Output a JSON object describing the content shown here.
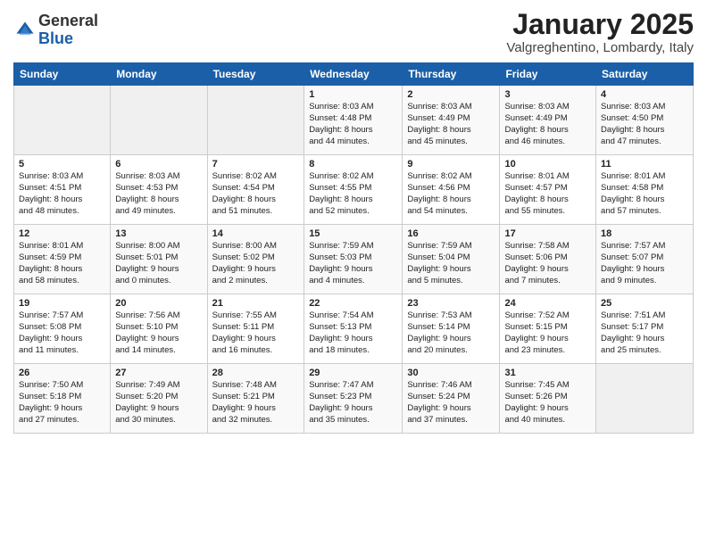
{
  "logo": {
    "general": "General",
    "blue": "Blue"
  },
  "header": {
    "month": "January 2025",
    "location": "Valgreghentino, Lombardy, Italy"
  },
  "weekdays": [
    "Sunday",
    "Monday",
    "Tuesday",
    "Wednesday",
    "Thursday",
    "Friday",
    "Saturday"
  ],
  "weeks": [
    [
      {
        "day": "",
        "info": ""
      },
      {
        "day": "",
        "info": ""
      },
      {
        "day": "",
        "info": ""
      },
      {
        "day": "1",
        "info": "Sunrise: 8:03 AM\nSunset: 4:48 PM\nDaylight: 8 hours\nand 44 minutes."
      },
      {
        "day": "2",
        "info": "Sunrise: 8:03 AM\nSunset: 4:49 PM\nDaylight: 8 hours\nand 45 minutes."
      },
      {
        "day": "3",
        "info": "Sunrise: 8:03 AM\nSunset: 4:49 PM\nDaylight: 8 hours\nand 46 minutes."
      },
      {
        "day": "4",
        "info": "Sunrise: 8:03 AM\nSunset: 4:50 PM\nDaylight: 8 hours\nand 47 minutes."
      }
    ],
    [
      {
        "day": "5",
        "info": "Sunrise: 8:03 AM\nSunset: 4:51 PM\nDaylight: 8 hours\nand 48 minutes."
      },
      {
        "day": "6",
        "info": "Sunrise: 8:03 AM\nSunset: 4:53 PM\nDaylight: 8 hours\nand 49 minutes."
      },
      {
        "day": "7",
        "info": "Sunrise: 8:02 AM\nSunset: 4:54 PM\nDaylight: 8 hours\nand 51 minutes."
      },
      {
        "day": "8",
        "info": "Sunrise: 8:02 AM\nSunset: 4:55 PM\nDaylight: 8 hours\nand 52 minutes."
      },
      {
        "day": "9",
        "info": "Sunrise: 8:02 AM\nSunset: 4:56 PM\nDaylight: 8 hours\nand 54 minutes."
      },
      {
        "day": "10",
        "info": "Sunrise: 8:01 AM\nSunset: 4:57 PM\nDaylight: 8 hours\nand 55 minutes."
      },
      {
        "day": "11",
        "info": "Sunrise: 8:01 AM\nSunset: 4:58 PM\nDaylight: 8 hours\nand 57 minutes."
      }
    ],
    [
      {
        "day": "12",
        "info": "Sunrise: 8:01 AM\nSunset: 4:59 PM\nDaylight: 8 hours\nand 58 minutes."
      },
      {
        "day": "13",
        "info": "Sunrise: 8:00 AM\nSunset: 5:01 PM\nDaylight: 9 hours\nand 0 minutes."
      },
      {
        "day": "14",
        "info": "Sunrise: 8:00 AM\nSunset: 5:02 PM\nDaylight: 9 hours\nand 2 minutes."
      },
      {
        "day": "15",
        "info": "Sunrise: 7:59 AM\nSunset: 5:03 PM\nDaylight: 9 hours\nand 4 minutes."
      },
      {
        "day": "16",
        "info": "Sunrise: 7:59 AM\nSunset: 5:04 PM\nDaylight: 9 hours\nand 5 minutes."
      },
      {
        "day": "17",
        "info": "Sunrise: 7:58 AM\nSunset: 5:06 PM\nDaylight: 9 hours\nand 7 minutes."
      },
      {
        "day": "18",
        "info": "Sunrise: 7:57 AM\nSunset: 5:07 PM\nDaylight: 9 hours\nand 9 minutes."
      }
    ],
    [
      {
        "day": "19",
        "info": "Sunrise: 7:57 AM\nSunset: 5:08 PM\nDaylight: 9 hours\nand 11 minutes."
      },
      {
        "day": "20",
        "info": "Sunrise: 7:56 AM\nSunset: 5:10 PM\nDaylight: 9 hours\nand 14 minutes."
      },
      {
        "day": "21",
        "info": "Sunrise: 7:55 AM\nSunset: 5:11 PM\nDaylight: 9 hours\nand 16 minutes."
      },
      {
        "day": "22",
        "info": "Sunrise: 7:54 AM\nSunset: 5:13 PM\nDaylight: 9 hours\nand 18 minutes."
      },
      {
        "day": "23",
        "info": "Sunrise: 7:53 AM\nSunset: 5:14 PM\nDaylight: 9 hours\nand 20 minutes."
      },
      {
        "day": "24",
        "info": "Sunrise: 7:52 AM\nSunset: 5:15 PM\nDaylight: 9 hours\nand 23 minutes."
      },
      {
        "day": "25",
        "info": "Sunrise: 7:51 AM\nSunset: 5:17 PM\nDaylight: 9 hours\nand 25 minutes."
      }
    ],
    [
      {
        "day": "26",
        "info": "Sunrise: 7:50 AM\nSunset: 5:18 PM\nDaylight: 9 hours\nand 27 minutes."
      },
      {
        "day": "27",
        "info": "Sunrise: 7:49 AM\nSunset: 5:20 PM\nDaylight: 9 hours\nand 30 minutes."
      },
      {
        "day": "28",
        "info": "Sunrise: 7:48 AM\nSunset: 5:21 PM\nDaylight: 9 hours\nand 32 minutes."
      },
      {
        "day": "29",
        "info": "Sunrise: 7:47 AM\nSunset: 5:23 PM\nDaylight: 9 hours\nand 35 minutes."
      },
      {
        "day": "30",
        "info": "Sunrise: 7:46 AM\nSunset: 5:24 PM\nDaylight: 9 hours\nand 37 minutes."
      },
      {
        "day": "31",
        "info": "Sunrise: 7:45 AM\nSunset: 5:26 PM\nDaylight: 9 hours\nand 40 minutes."
      },
      {
        "day": "",
        "info": ""
      }
    ]
  ]
}
